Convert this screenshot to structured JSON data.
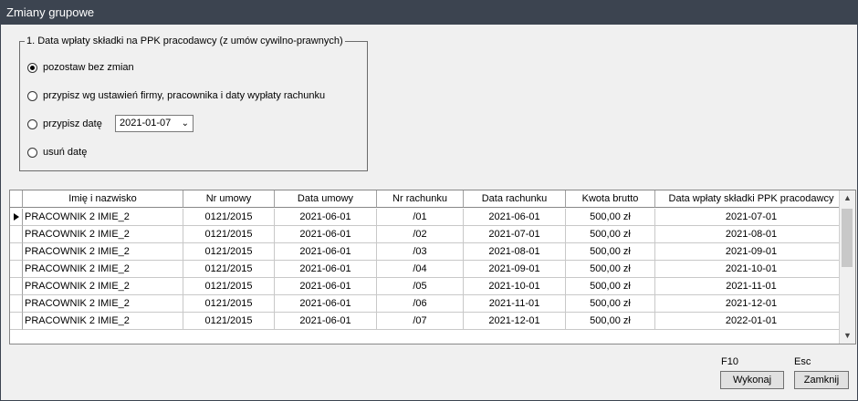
{
  "window": {
    "title": "Zmiany grupowe"
  },
  "group": {
    "legend": "1. Data wpłaty składki na PPK  pracodawcy (z umów cywilno-prawnych)",
    "options": [
      {
        "label": "pozostaw bez zmian",
        "checked": true
      },
      {
        "label": "przypisz wg ustawień firmy, pracownika i daty wypłaty rachunku",
        "checked": false
      },
      {
        "label": "przypisz datę",
        "checked": false
      },
      {
        "label": "usuń datę",
        "checked": false
      }
    ],
    "date_value": "2021-01-07"
  },
  "table": {
    "columns": [
      "Imię i nazwisko",
      "Nr umowy",
      "Data umowy",
      "Nr rachunku",
      "Data rachunku",
      "Kwota brutto",
      "Data wpłaty składki PPK pracodawcy"
    ],
    "rows": [
      [
        "PRACOWNIK 2 IMIE_2",
        "0121/2015",
        "2021-06-01",
        "/01",
        "2021-06-01",
        "500,00 zł",
        "2021-07-01"
      ],
      [
        "PRACOWNIK 2 IMIE_2",
        "0121/2015",
        "2021-06-01",
        "/02",
        "2021-07-01",
        "500,00 zł",
        "2021-08-01"
      ],
      [
        "PRACOWNIK 2 IMIE_2",
        "0121/2015",
        "2021-06-01",
        "/03",
        "2021-08-01",
        "500,00 zł",
        "2021-09-01"
      ],
      [
        "PRACOWNIK 2 IMIE_2",
        "0121/2015",
        "2021-06-01",
        "/04",
        "2021-09-01",
        "500,00 zł",
        "2021-10-01"
      ],
      [
        "PRACOWNIK 2 IMIE_2",
        "0121/2015",
        "2021-06-01",
        "/05",
        "2021-10-01",
        "500,00 zł",
        "2021-11-01"
      ],
      [
        "PRACOWNIK 2 IMIE_2",
        "0121/2015",
        "2021-06-01",
        "/06",
        "2021-11-01",
        "500,00 zł",
        "2021-12-01"
      ],
      [
        "PRACOWNIK 2 IMIE_2",
        "0121/2015",
        "2021-06-01",
        "/07",
        "2021-12-01",
        "500,00 zł",
        "2022-01-01"
      ]
    ]
  },
  "footer": {
    "execute_key": "F10",
    "execute_label": "Wykonaj",
    "close_key": "Esc",
    "close_label": "Zamknij"
  }
}
